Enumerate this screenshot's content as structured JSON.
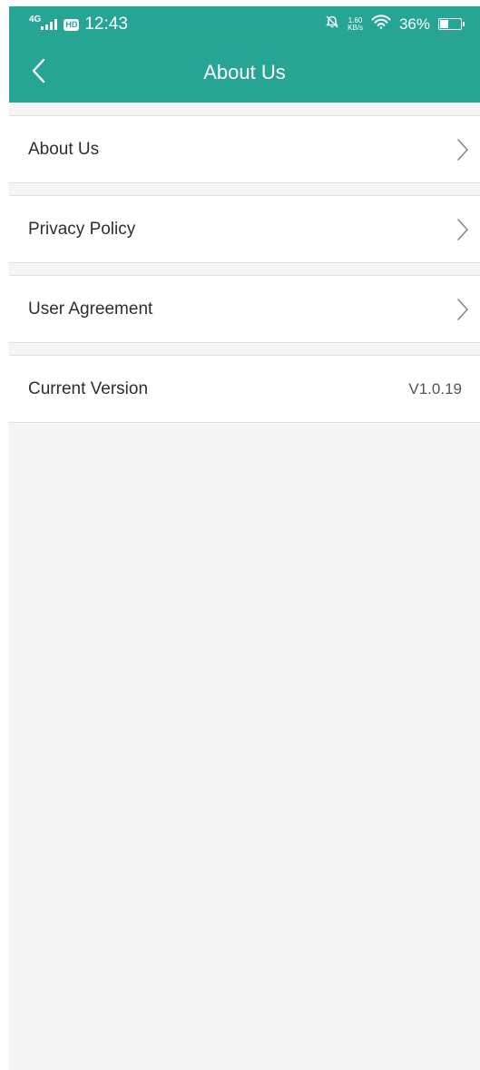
{
  "status": {
    "network": "4G",
    "hd": "HD",
    "time": "12:43",
    "speed_value": "1.60",
    "speed_unit": "KB/s",
    "battery": "36%"
  },
  "header": {
    "title": "About Us"
  },
  "list": {
    "about_us": "About Us",
    "privacy_policy": "Privacy Policy",
    "user_agreement": "User Agreement",
    "current_version_label": "Current Version",
    "current_version_value": "V1.0.19"
  },
  "colors": {
    "header_bg": "#26a595",
    "page_bg": "#f4f4f4"
  },
  "icons": {
    "back": "chevron-left-icon",
    "row_arrow": "chevron-right-icon"
  }
}
